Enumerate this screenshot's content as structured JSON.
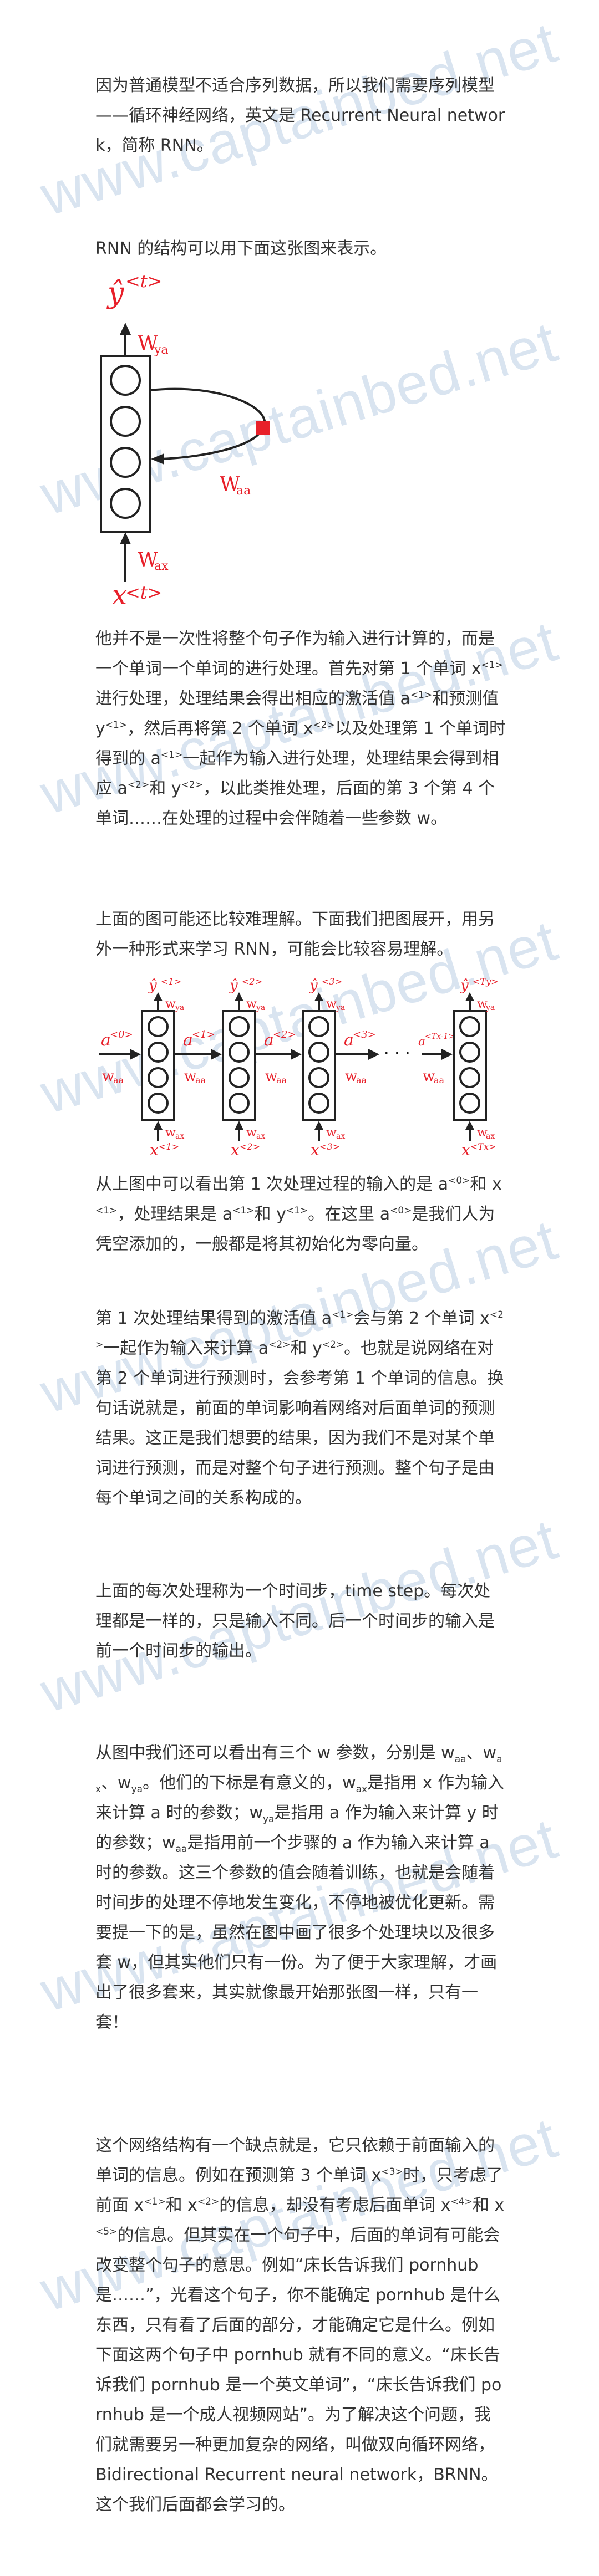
{
  "watermark": {
    "text": "www.captainbed.net",
    "color": "#82a5cd"
  },
  "paragraphs": {
    "p1": "因为普通模型不适合序列数据，所以我们需要序列模型——循环神经网络，英文是 Recurrent Neural network，简称 RNN。",
    "p2": "RNN 的结构可以用下面这张图来表示。",
    "p3": {
      "t1": "他并不是一次性将整个句子作为输入进行计算的，而是一个单词一个单词的进行处理。首先对第 1 个单词 x",
      "t2": "进行处理，处理结果会得出相应的激活值 a",
      "t3": "和预测值 y",
      "t4": "，然后再将第 2 个单词 x",
      "t5": "以及处理第 1 个单词时得到的 a",
      "t6": "一起作为输入进行处理，处理结果会得到相应 a",
      "t7": "和 y",
      "t8": "，以此类推处理，后面的第 3 个第 4 个单词……在处理的过程中会伴随着一些参数 w。"
    },
    "p4": "上面的图可能还比较难理解。下面我们把图展开，用另外一种形式来学习 RNN，可能会比较容易理解。",
    "p5": {
      "t1": "从上图中可以看出第 1 次处理过程的输入的是 a",
      "t2": "和 x",
      "t3": "，处理结果是 a",
      "t4": "和 y",
      "t5": "。在这里 a",
      "t6": "是我们人为凭空添加的，一般都是将其初始化为零向量。"
    },
    "p6": {
      "t1": "第 1 次处理结果得到的激活值 a",
      "t2": "会与第 2 个单词 x",
      "t3": "一起作为输入来计算 a",
      "t4": "和 y",
      "t5": "。也就是说网络在对第 2 个单词进行预测时，会参考第 1 个单词的信息。换句话说就是，前面的单词影响着网络对后面单词的预测结果。这正是我们想要的结果，因为我们不是对某个单词进行预测，而是对整个句子进行预测。整个句子是由每个单词之间的关系构成的。"
    },
    "p7": "上面的每次处理称为一个时间步，time step。每次处理都是一样的，只是输入不同。后一个时间步的输入是前一个时间步的输出。",
    "p8": {
      "t1": "从图中我们还可以看出有三个 w 参数，分别是 w",
      "t2": "、w",
      "t3": "、w",
      "t4": "。他们的下标是有意义的，w",
      "t5": "是指用 x 作为输入来计算 a 时的参数；w",
      "t6": "是指用 a 作为输入来计算 y 时的参数；w",
      "t7": "是指用前一个步骤的 a 作为输入来计算 a 时的参数。这三个参数的值会随着训练，也就是会随着时间步的处理不停地发生变化，不停地被优化更新。需要提一下的是，虽然在图中画了很多个处理块以及很多套 w，但其实他们只有一份。为了便于大家理解，才画出了很多套来，其实就像最开始那张图一样，只有一套！"
    },
    "p9": {
      "t1": "这个网络结构有一个缺点就是，它只依赖于前面输入的单词的信息。例如在预测第 3 个单词 x",
      "t2": "时，只考虑了前面 x",
      "t3": "和 x",
      "t4": "的信息，却没有考虑后面单词 x",
      "t5": "和 x",
      "t6": "的信息。但其实在一个句子中，后面的单词有可能会改变整个句子的意思。例如“床长告诉我们 pornhub 是……”，光看这个句子，你不能确定 pornhub 是什么东西，只有看了后面的部分，才能确定它是什么。例如下面这两个句子中 pornhub 就有不同的意义。“床长告诉我们 pornhub 是一个英文单词”，“床长告诉我们 pornhub 是一个成人视频网站”。为了解决这个问题，我们就需要另一种更加复杂的网络，叫做双向循环网络，Bidirectional Recurrent neural network，BRNN。这个我们后面都会学习的。"
    }
  },
  "sups": {
    "s1": "<1>",
    "s2": "<2>",
    "s3": "<3>",
    "s4": "<4>",
    "s5": "<5>",
    "s0": "<0>"
  },
  "subs": {
    "aa": "aa",
    "ax": "ax",
    "ya": "ya"
  },
  "diagram1": {
    "y_hat": "ŷ",
    "t_sup": "<t>",
    "x": "x",
    "w_ya": "W",
    "w_ya_sub": "ya",
    "w_aa": "W",
    "w_aa_sub": "aa",
    "w_ax": "W",
    "w_ax_sub": "ax"
  },
  "diagram2": {
    "y_hat": "ŷ",
    "a": "a",
    "x": "x",
    "w": "w",
    "sub_ya": "ya",
    "sub_aa": "aa",
    "sub_ax": "ax",
    "ellipsis": "· · ·",
    "steps": [
      "<1>",
      "<2>",
      "<3>"
    ],
    "last_sup": "<Ty>",
    "last_x_sup": "<Tx>",
    "a_steps": [
      "<0>",
      "<1>",
      "<2>",
      "<3>",
      "<Tx-1>"
    ]
  }
}
